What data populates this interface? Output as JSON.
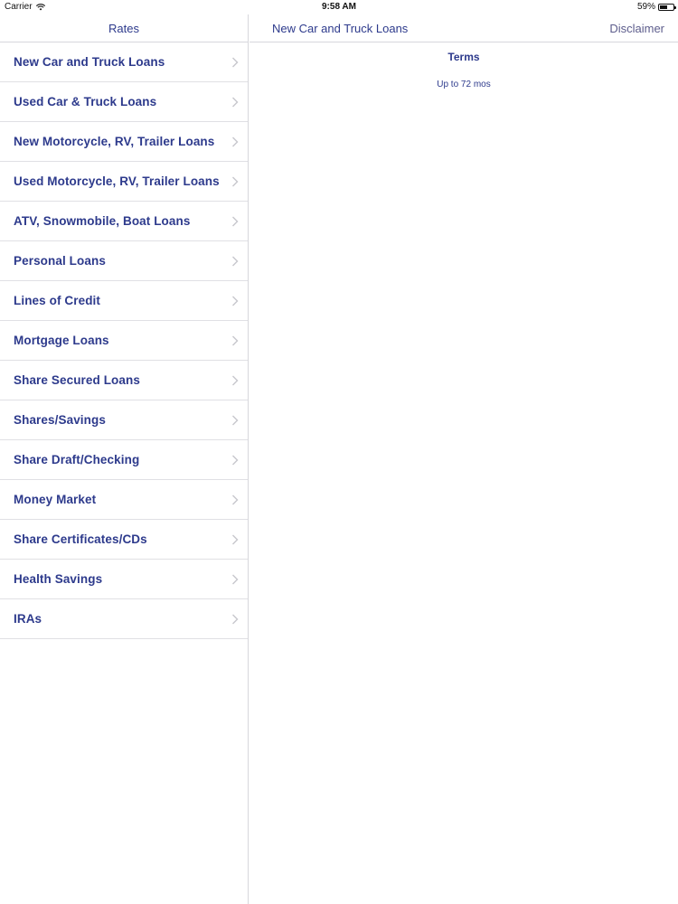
{
  "status_bar": {
    "carrier": "Carrier",
    "time": "9:58 AM",
    "battery": "59%",
    "battery_level": 0.59
  },
  "master": {
    "title": "Rates",
    "items": [
      {
        "label": "New Car and Truck Loans"
      },
      {
        "label": "Used Car & Truck Loans"
      },
      {
        "label": "New Motorcycle, RV, Trailer Loans"
      },
      {
        "label": "Used Motorcycle, RV, Trailer Loans"
      },
      {
        "label": "ATV, Snowmobile, Boat Loans"
      },
      {
        "label": "Personal Loans"
      },
      {
        "label": "Lines of Credit"
      },
      {
        "label": "Mortgage Loans"
      },
      {
        "label": "Share Secured Loans"
      },
      {
        "label": "Shares/Savings"
      },
      {
        "label": "Share Draft/Checking"
      },
      {
        "label": "Money Market"
      },
      {
        "label": "Share Certificates/CDs"
      },
      {
        "label": "Health Savings"
      },
      {
        "label": "IRAs"
      }
    ]
  },
  "detail": {
    "title": "New Car and Truck Loans",
    "action": "Disclaimer",
    "terms_heading": "Terms",
    "terms_value": "Up to 72 mos"
  },
  "colors": {
    "accent": "#2d3a8c",
    "separator": "#e0e0e4"
  }
}
